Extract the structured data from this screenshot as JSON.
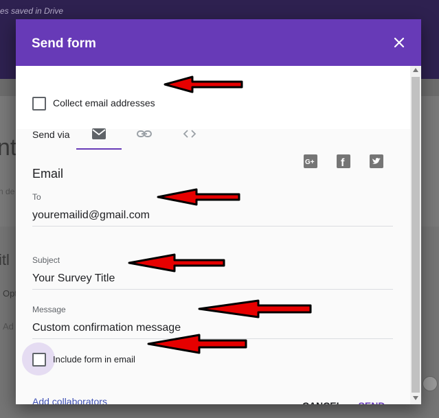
{
  "background": {
    "saved_text": "es saved in Drive",
    "title_fragment": "nt",
    "desc_fragment": "n de",
    "question_fragment": "itl",
    "option_fragment": "Opt",
    "add_fragment": "Ad"
  },
  "dialog": {
    "title": "Send form",
    "close_icon": "close-icon",
    "collect_email_label": "Collect email addresses",
    "send_via_label": "Send via",
    "tabs": [
      {
        "icon": "email-icon",
        "selected": true
      },
      {
        "icon": "link-icon",
        "selected": false
      },
      {
        "icon": "embed-icon",
        "selected": false
      }
    ],
    "share_icons": [
      "google-plus-icon",
      "facebook-icon",
      "twitter-icon"
    ],
    "section_title": "Email",
    "to": {
      "label": "To",
      "value": "youremailid@gmail.com"
    },
    "subject": {
      "label": "Subject",
      "value": "Your Survey Title"
    },
    "message": {
      "label": "Message",
      "value": "Custom confirmation message"
    },
    "include_form_label": "Include form in email",
    "add_collaborators": "Add collaborators",
    "cancel": "CANCEL",
    "send": "SEND"
  },
  "colors": {
    "accent": "#673ab7",
    "arrow": "#e60000"
  }
}
